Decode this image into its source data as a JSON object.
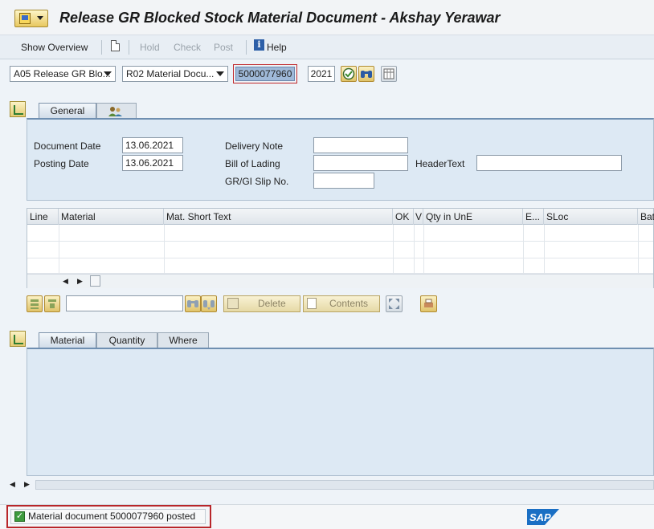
{
  "window": {
    "title": "Release GR Blocked Stock Material Document - Akshay Yerawar"
  },
  "toolbar": {
    "show_overview": "Show Overview",
    "hold": "Hold",
    "check": "Check",
    "post": "Post",
    "help": "Help"
  },
  "selection": {
    "action": "A05 Release GR Blo...",
    "reference": "R02 Material Docu...",
    "document_number": "5000077960",
    "year": "2021"
  },
  "header_tabs": [
    "General",
    "partner-icon"
  ],
  "header": {
    "document_date_label": "Document Date",
    "document_date": "13.06.2021",
    "posting_date_label": "Posting Date",
    "posting_date": "13.06.2021",
    "delivery_note_label": "Delivery Note",
    "delivery_note": "",
    "bill_of_lading_label": "Bill of Lading",
    "bill_of_lading": "",
    "gr_gi_slip_label": "GR/GI Slip No.",
    "gr_gi_slip": "",
    "header_text_label": "HeaderText",
    "header_text": ""
  },
  "table": {
    "columns": [
      "Line",
      "Material",
      "Mat. Short Text",
      "OK",
      "V",
      "Qty in UnE",
      "E...",
      "SLoc",
      "Bat"
    ],
    "rows": [
      [],
      [],
      []
    ]
  },
  "table_toolbar": {
    "search_value": "",
    "delete": "Delete",
    "contents": "Contents"
  },
  "item_tabs": [
    "Material",
    "Quantity",
    "Where"
  ],
  "status": {
    "message": "Material document 5000077960 posted",
    "type": "success"
  },
  "brand": {
    "logo_text": "SAP",
    "logo_color": "#1a6fc4"
  }
}
